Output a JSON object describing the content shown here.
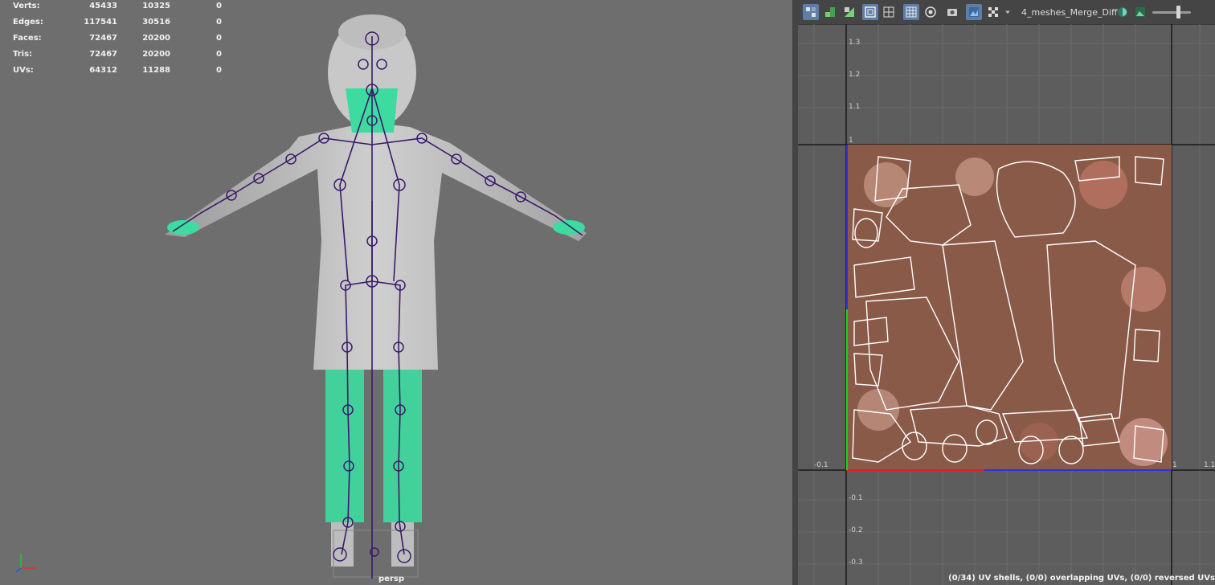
{
  "hud": {
    "rows": [
      {
        "label": "Verts:",
        "v1": "45433",
        "v2": "10325",
        "v3": "0"
      },
      {
        "label": "Edges:",
        "v1": "117541",
        "v2": "30516",
        "v3": "0"
      },
      {
        "label": "Faces:",
        "v1": "72467",
        "v2": "20200",
        "v3": "0"
      },
      {
        "label": "Tris:",
        "v1": "72467",
        "v2": "20200",
        "v3": "0"
      },
      {
        "label": "UVs:",
        "v1": "64312",
        "v2": "11288",
        "v3": "0"
      }
    ]
  },
  "viewport": {
    "camera_label": "persp",
    "axis_icon": "xyz-axis-icon"
  },
  "uv_editor": {
    "texture_name": "4_meshes_Merge_Diff",
    "toolbar_icons": [
      "uv-shell-icon",
      "checker-grid-icon",
      "shaded-icon",
      "frame-icon",
      "grid-icon",
      "grid-toggle-icon",
      "pivot-icon",
      "snapshot-icon",
      "image-display-icon",
      "checker-icon",
      "dropdown-icon",
      "exposure-icon",
      "image-icon"
    ],
    "v_ticks": [
      "1.3",
      "1.2",
      "1.1",
      "1",
      "-0.1",
      "-0.2",
      "-0.3"
    ],
    "u_ticks": [
      "-0.1",
      "1",
      "1.1"
    ],
    "status": "(0/34) UV shells, (0/0) overlapping UVs, (0/0) reversed UVs",
    "colors": {
      "u_axis": "#ff2020",
      "v_axis": "#20ff20",
      "shell_wire": "#ffffff",
      "texture": "#8a5a48"
    }
  }
}
